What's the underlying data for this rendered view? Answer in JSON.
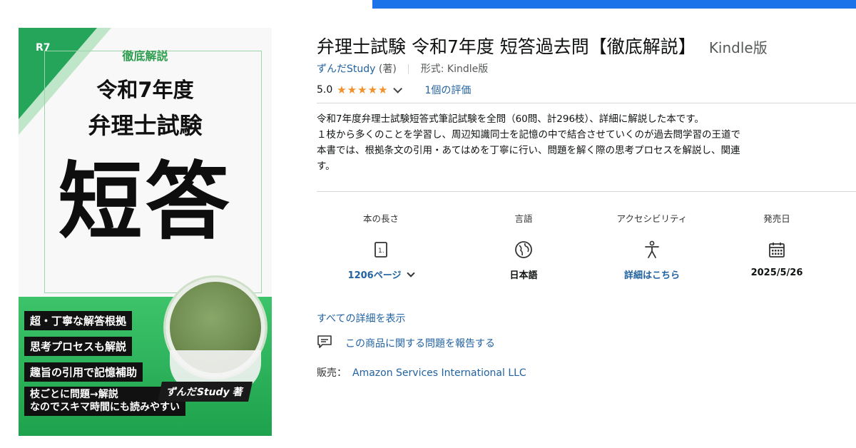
{
  "cover": {
    "series": "R7",
    "subtitle": "徹底解説",
    "line1": "令和7年度",
    "line2": "弁理士試験",
    "big": "短答",
    "bullets": [
      "超・丁寧な解答根拠",
      "思考プロセスも解説",
      "趣旨の引用で記憶補助",
      "枝ごとに問題→解説\nなのでスキマ時間にも読みやすい"
    ],
    "author": "ずんだStudy 著"
  },
  "product": {
    "title": "弁理士試験 令和7年度 短答過去問【徹底解説】",
    "format_label": "Kindle版",
    "author_link": "ずんだStudy",
    "author_role": "(著)",
    "format_prefix": "形式: Kindle版",
    "rating_value": "5.0",
    "stars": "★★★★★",
    "reviews": "1個の評価",
    "description": [
      "令和7年度弁理士試験短答式筆記試験を全問（60問、計296枝）、詳細に解説した本です。",
      "１枝から多くのことを学習し、周辺知識同士を記憶の中で結合させていくのが過去問学習の王道で",
      "本書では、根拠条文の引用・あてはめを丁寧に行い、問題を解く際の思考プロセスを解説し、関連",
      "す。"
    ]
  },
  "specs": [
    {
      "label": "本の長さ",
      "icon": "page-icon",
      "value": "1206ページ"
    },
    {
      "label": "言語",
      "icon": "globe-icon",
      "value": "日本語"
    },
    {
      "label": "アクセシビリティ",
      "icon": "accessibility-icon",
      "value": "詳細はこちら"
    },
    {
      "label": "発売日",
      "icon": "calendar-icon",
      "value": "2025/5/26"
    }
  ],
  "links": {
    "all_details": "すべての詳細を表示",
    "report": "この商品に関する問題を報告する",
    "seller_label": "販売：",
    "seller_name": "Amazon Services International LLC"
  }
}
